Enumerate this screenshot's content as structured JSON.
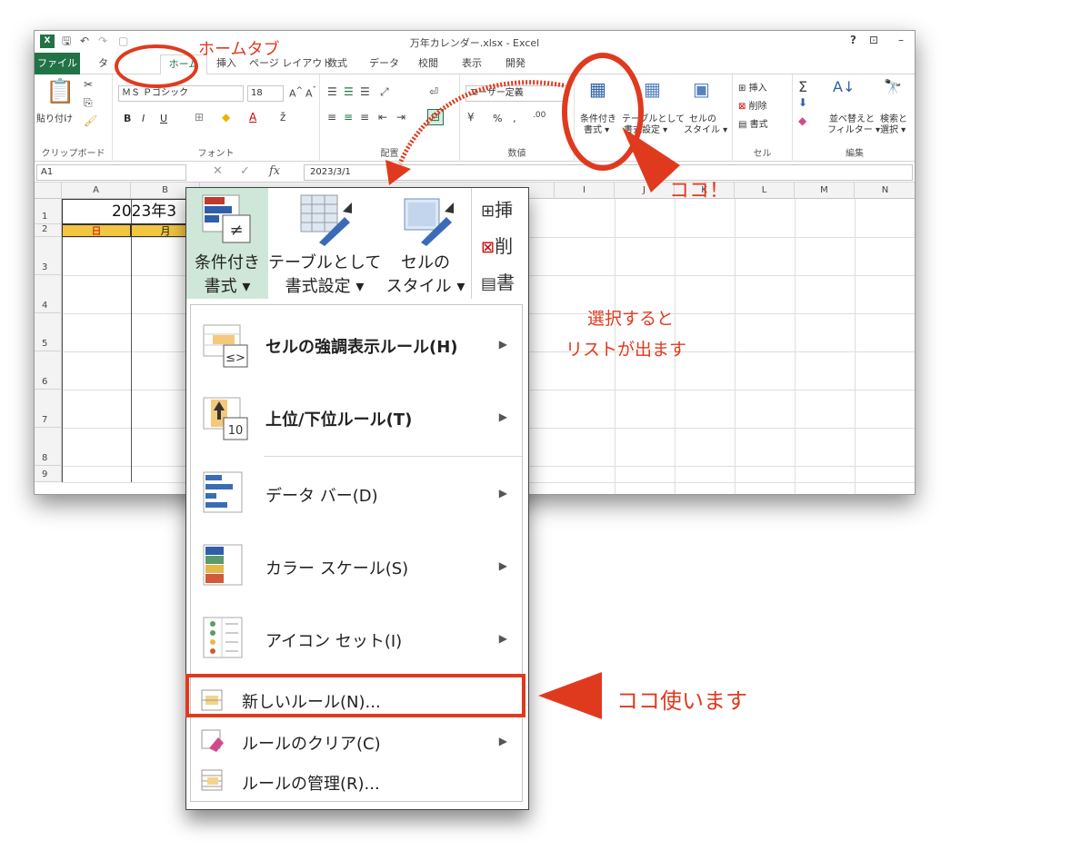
{
  "title_bar": {
    "title": "万年カレンダー.xlsx - Excel",
    "logo": "X",
    "help": "?",
    "ribbon_display": "⊡",
    "minimize": "–"
  },
  "tabs": [
    "ファイル",
    "ホーム",
    "挿入",
    "ページ レイアウト",
    "数式",
    "データ",
    "校閲",
    "表示",
    "開発"
  ],
  "ribbon": {
    "clipboard": {
      "paste": "貼り付け",
      "label": "クリップボード"
    },
    "font": {
      "name": "ＭＳ Ｐゴシック",
      "size": "18",
      "bold": "B",
      "italic": "I",
      "underline": "U",
      "label": "フォント"
    },
    "alignment": {
      "label": "配置"
    },
    "number": {
      "format": "ユーザー定義",
      "percent": "%",
      "comma": ",",
      "label": "数値"
    },
    "styles": {
      "conditional": "条件付き\n書式",
      "conditional_1": "条件付き",
      "conditional_2": "書式 ▾",
      "table_1": "テーブルとして",
      "table_2": "書式設定 ▾",
      "cell_1": "セルの",
      "cell_2": "スタイル ▾"
    },
    "cells": {
      "insert": "挿入",
      "delete": "削除",
      "format": "書式",
      "label": "セル"
    },
    "editing": {
      "sort_1": "並べ替えと",
      "sort_2": "フィルター ▾",
      "find_1": "検索と",
      "find_2": "選択 ▾",
      "label": "編集"
    }
  },
  "formula_bar": {
    "name_box": "A1",
    "fx": "fx",
    "cancel": "✕",
    "enter": "✓",
    "value": "2023/3/1"
  },
  "grid": {
    "columns": [
      "A",
      "B",
      "I",
      "J",
      "K",
      "L",
      "M",
      "N"
    ],
    "rows": [
      "1",
      "2",
      "3",
      "4",
      "5",
      "6",
      "7",
      "8",
      "9"
    ],
    "calendar_title": "2023年3",
    "day_headers": [
      "日",
      "月"
    ]
  },
  "dropdown": {
    "big_buttons": {
      "conditional_1": "条件付き",
      "conditional_2": "書式 ▾",
      "table_1": "テーブルとして",
      "table_2": "書式設定 ▾",
      "cell_1": "セルの",
      "cell_2": "スタイル ▾"
    },
    "side": {
      "insert": "挿",
      "delete": "削",
      "format": "書"
    },
    "menu_items": [
      {
        "label": "セルの強調表示ルール(H)",
        "has_submenu": true
      },
      {
        "label": "上位/下位ルール(T)",
        "has_submenu": true
      },
      {
        "label": "データ バー(D)",
        "has_submenu": true
      },
      {
        "label": "カラー スケール(S)",
        "has_submenu": true
      },
      {
        "label": "アイコン セット(I)",
        "has_submenu": true
      },
      {
        "label": "新しいルール(N)...",
        "has_submenu": false
      },
      {
        "label": "ルールのクリア(C)",
        "has_submenu": true
      },
      {
        "label": "ルールの管理(R)...",
        "has_submenu": false
      }
    ],
    "topbottom_icon_number": "10"
  },
  "annotations": {
    "home_tab": "ホームタブ",
    "here": "ココ！",
    "list_note_1": "選択すると",
    "list_note_2": "リストが出ます",
    "use_here": "ココ使います"
  },
  "colors": {
    "excel_green": "#217346",
    "annotation_red": "#e03a1e",
    "header_yellow": "#f2c641"
  }
}
